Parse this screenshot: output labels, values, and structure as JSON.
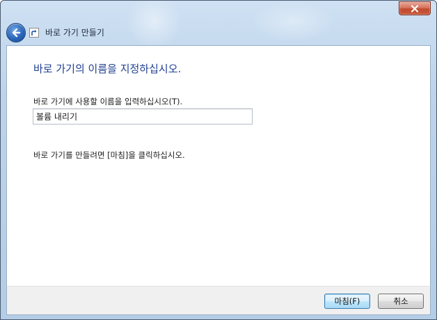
{
  "window": {
    "title": "바로 가기 만들기",
    "close_icon": "close-icon",
    "back_icon": "back-arrow-icon",
    "shortcut_icon": "shortcut-arrow-icon"
  },
  "main": {
    "heading": "바로 가기의 이름을 지정하십시오.",
    "name_label": "바로 가기에 사용할 이름을 입력하십시오(T).",
    "name_value": "볼륨 내리기",
    "hint": "바로 가기를 만들려면 [마침]을 클릭하십시오."
  },
  "footer": {
    "finish_label": "마침(F)",
    "cancel_label": "취소"
  },
  "colors": {
    "heading": "#1f3f8f",
    "title_bar": "#bcd3ea",
    "close_button": "#c9593b",
    "default_button_border": "#3c7fb1"
  }
}
